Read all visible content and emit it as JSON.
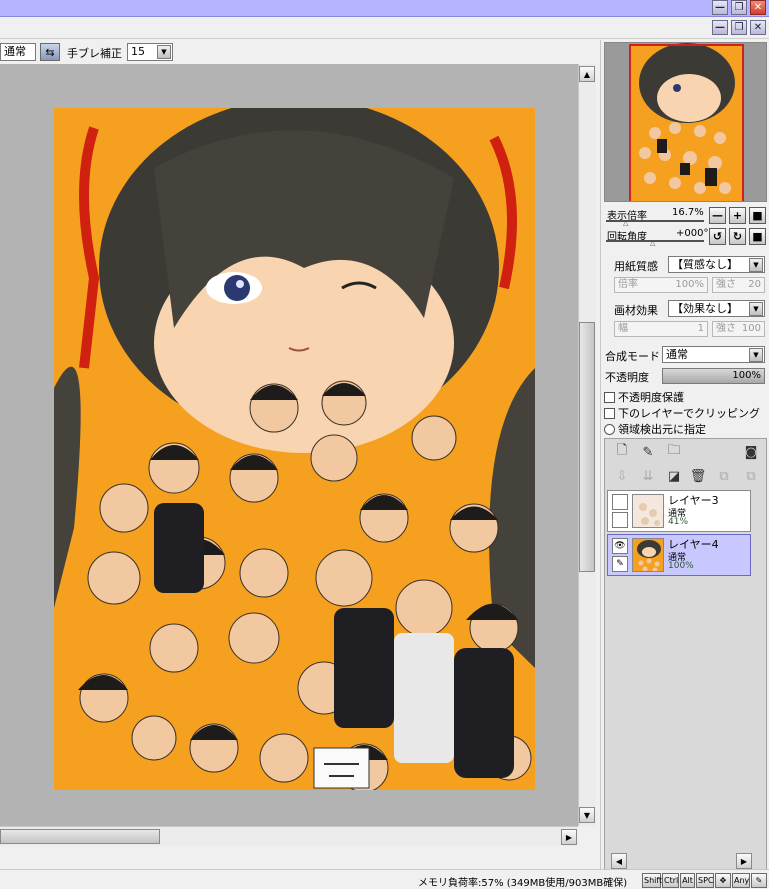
{
  "window_controls": {
    "minimize": "—",
    "restore": "❐",
    "close": "✕"
  },
  "toolbar": {
    "blend_mode": "通常",
    "stabilizer_label": "手ブレ補正",
    "stabilizer_value": "15"
  },
  "navigator": {
    "zoom_label": "表示倍率",
    "zoom_value": "16.7%",
    "rotate_label": "回転角度",
    "rotate_value": "+000°"
  },
  "paper": {
    "texture_label": "用紙質感",
    "texture_value": "【質感なし】",
    "scale_label": "倍率",
    "scale_value": "100%",
    "strength_label": "強さ",
    "strength_value": "20",
    "effect_label": "画材効果",
    "effect_value": "【効果なし】",
    "width_label": "幅",
    "width_value": "1",
    "effect_strength_label": "強さ",
    "effect_strength_value": "100"
  },
  "layer_props": {
    "blend_label": "合成モード",
    "blend_value": "通常",
    "opacity_label": "不透明度",
    "opacity_value": "100%",
    "opacity_fraction": 1.0,
    "protect_alpha": "不透明度保護",
    "clip_lower": "下のレイヤーでクリッピング",
    "selection_source": "領域検出元に指定"
  },
  "layers": [
    {
      "name": "レイヤー3",
      "mode": "通常",
      "opacity": "41%",
      "visible": false,
      "active": false
    },
    {
      "name": "レイヤー4",
      "mode": "通常",
      "opacity": "100%",
      "visible": true,
      "active": true
    }
  ],
  "status": {
    "memory": "メモリ負荷率:57% (349MB使用/903MB確保)",
    "keys": [
      "Shift",
      "Ctrl",
      "Alt",
      "SPC",
      "✥",
      "Any",
      "✎"
    ]
  },
  "colors": {
    "title_bar": "#b4b4ff",
    "active_layer": "#c8c8ff",
    "canvas_bg": "#b3b3b3",
    "artwork_bg": "#f6a020"
  }
}
